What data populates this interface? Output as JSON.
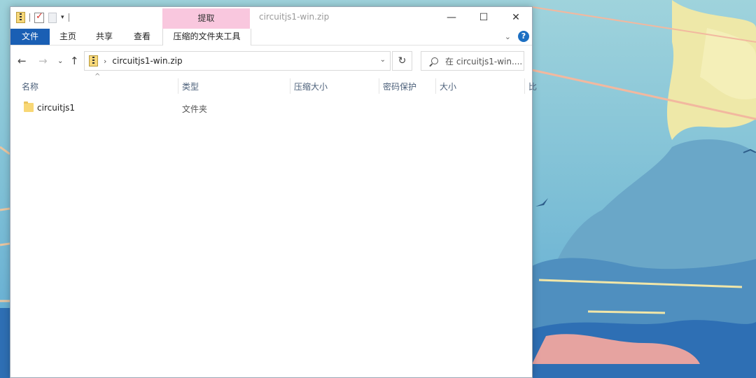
{
  "titlebar": {
    "context_tab": "提取",
    "window_title": "circuitjs1-win.zip",
    "minimize_icon": "minimize-icon",
    "maximize_icon": "maximize-icon",
    "close_icon": "close-icon"
  },
  "ribbon": {
    "tabs": [
      {
        "label": "文件"
      },
      {
        "label": "主页"
      },
      {
        "label": "共享"
      },
      {
        "label": "查看"
      },
      {
        "label": "压缩的文件夹工具"
      }
    ]
  },
  "address": {
    "path": "circuitjs1-win.zip",
    "search_placeholder": "在 circuitjs1-win...."
  },
  "columns": [
    "名称",
    "类型",
    "压缩大小",
    "密码保护",
    "大小",
    "比"
  ],
  "files": [
    {
      "name": "circuitjs1",
      "type": "文件夹"
    }
  ],
  "colors": {
    "file_tab": "#1a5fb4",
    "context_tab": "#f9c7de",
    "help": "#1c6fc2"
  }
}
